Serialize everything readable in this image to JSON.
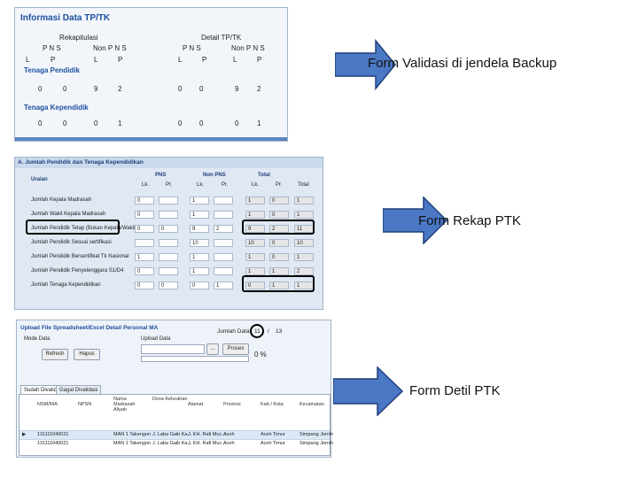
{
  "captions": {
    "backup": "Form Validasi di jendela Backup",
    "rekap": "Form Rekap PTK",
    "detil": "Form Detil PTK"
  },
  "shot1": {
    "title": "Informasi Data TP/TK",
    "rekapitulasi": "Rekapitulasi",
    "detail": "Detail TP/TK",
    "pns": "P N S",
    "non_pns": "Non P N S",
    "l": "L",
    "p": "P",
    "tenaga_pendidik": "Tenaga Pendidik",
    "tenaga_kependidik": "Tenaga Kependidik",
    "row_pendidik": [
      "0",
      "0",
      "9",
      "2",
      "0",
      "0",
      "9",
      "2"
    ],
    "row_kependidik": [
      "0",
      "0",
      "0",
      "1",
      "0",
      "0",
      "0",
      "1"
    ]
  },
  "shot2": {
    "title": "A. Jumlah Pendidik dan Tenaga Kependidikan",
    "col_uraian": "Uraian",
    "col_pns": "PNS",
    "col_non_pns": "Non PNS",
    "col_total": "Total",
    "lk": "Lk.",
    "pr": "Pr.",
    "total": "Total",
    "rows": [
      {
        "label": "Jumlah Kepala Madrasah",
        "vals": [
          "0",
          "",
          "1",
          "",
          "1",
          "0",
          "1"
        ]
      },
      {
        "label": "Jumlah Wakil Kepala Madrasah",
        "vals": [
          "0",
          "",
          "1",
          "",
          "1",
          "0",
          "1"
        ]
      },
      {
        "label": "Jumlah Pendidik Tetap (Bukan Kepala/Wakil)",
        "vals": [
          "0",
          "0",
          "9",
          "2",
          "9",
          "2",
          "11"
        ]
      },
      {
        "label": "Jumlah Pendidik Sesuai sertifikasi",
        "vals": [
          "",
          "",
          "10",
          "",
          "10",
          "0",
          "10"
        ]
      },
      {
        "label": "Jumlah Pendidik Bersertifikat Tk Nasional",
        "vals": [
          "1",
          "",
          "1",
          "",
          "1",
          "0",
          "1"
        ]
      },
      {
        "label": "Jumlah Pendidik Penyelenggara S1/D4",
        "vals": [
          "0",
          "",
          "1",
          "",
          "1",
          "1",
          "2"
        ]
      },
      {
        "label": "Jumlah Tenaga Kependidikan",
        "vals": [
          "0",
          "0",
          "0",
          "1",
          "0",
          "1",
          "1"
        ]
      }
    ]
  },
  "shot3": {
    "title": "Upload File Spreadsheet/Excel Detail Personal MA",
    "jumlah_data": "Jumlah Data",
    "count_current": "11",
    "count_sep": "/",
    "count_total": "13",
    "mode_label": "Mode Data",
    "upload_label": "Upload Data",
    "btn_refresh": "Refresh",
    "btn_hapus": "Hapus",
    "btn_browse": "...",
    "btn_proses": "Proses",
    "progress": "0 %",
    "tab_sudah": "Sudah Divalidasi",
    "tab_gagal": "Gagal Divalidasi",
    "headers": [
      "NSM/NIA",
      "NPSN",
      "Nama Madrasah Aliyah",
      "Desa Kelurahan",
      "Alamat",
      "Provinsi",
      "Kab / Kota",
      "Kecamatan"
    ],
    "rows": [
      [
        "131111040021",
        "",
        "MAN 1 Takengon",
        "J. Laba Gaib Ka...",
        "J. KH. Rafi Muc...",
        "Aceh",
        "Aceh Timur",
        "Simpang Jernih"
      ],
      [
        "131111040021",
        "",
        "MAN 1 Takengon",
        "J. Laba Gaib Ka...",
        "J. KH. Rafi Muc...",
        "Aceh",
        "Aceh Timur",
        "Simpang Jernih"
      ]
    ]
  },
  "colors": {
    "arrow_fill": "#4a78c4",
    "arrow_stroke": "#1f3f7a",
    "title_blue": "#1f4fa0"
  }
}
